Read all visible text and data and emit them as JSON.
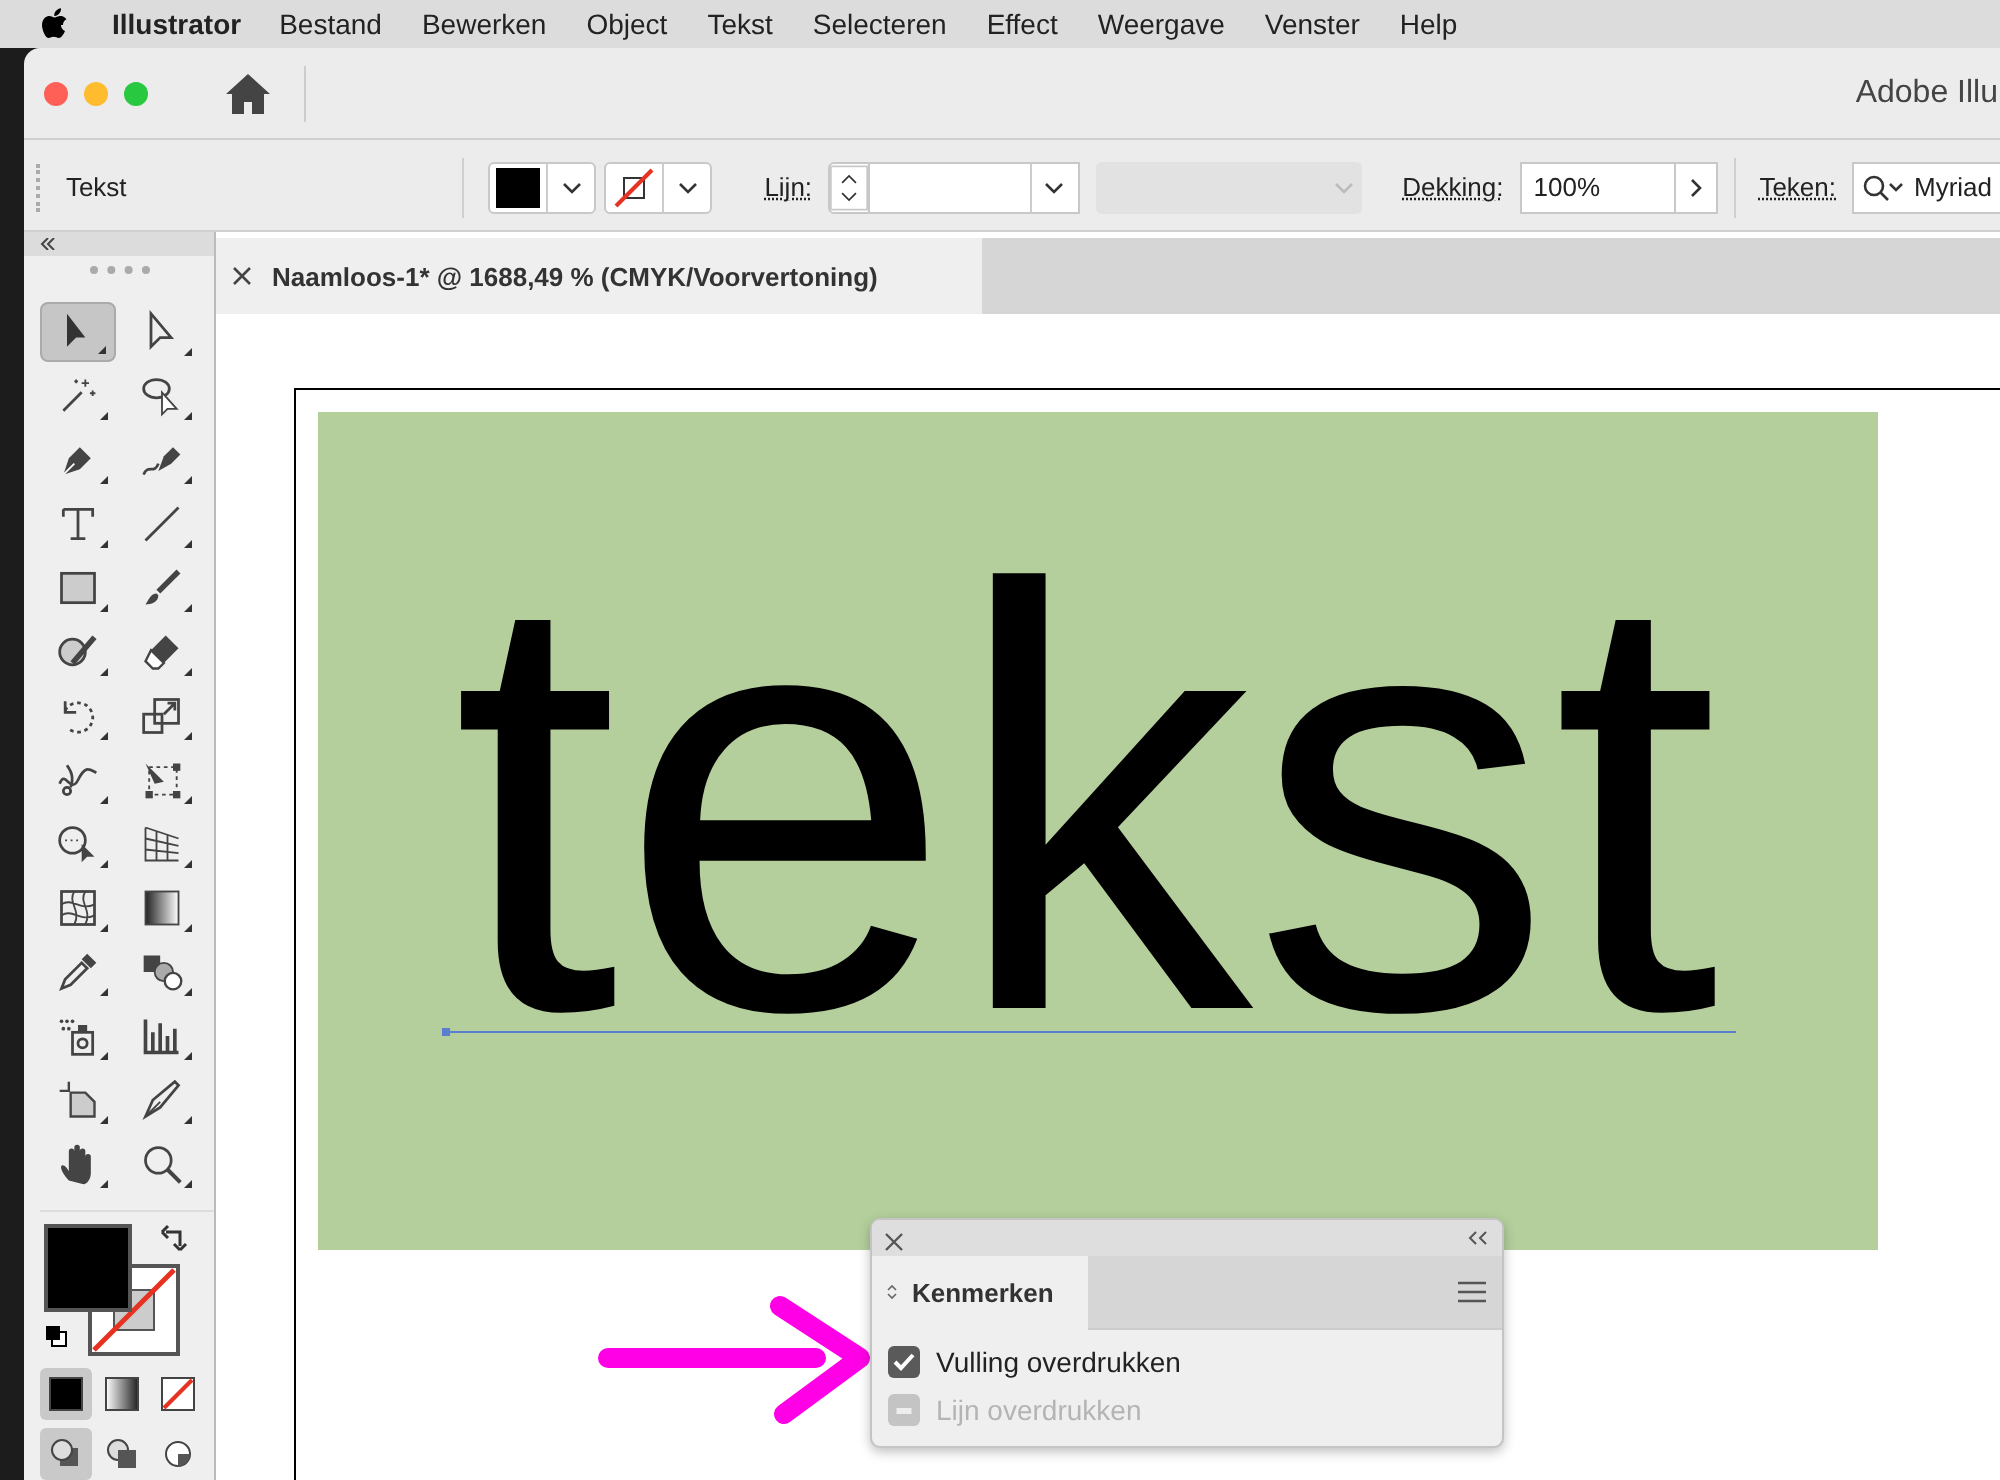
{
  "menu_bar": {
    "app_name": "Illustrator",
    "items": [
      "Bestand",
      "Bewerken",
      "Object",
      "Tekst",
      "Selecteren",
      "Effect",
      "Weergave",
      "Venster",
      "Help"
    ]
  },
  "window": {
    "title": "Adobe Illu"
  },
  "control_bar": {
    "selection_label": "Tekst",
    "stroke_label": "Lijn:",
    "opacity_label": "Dekking:",
    "opacity_value": "100%",
    "character_label": "Teken:",
    "font_value": "Myriad"
  },
  "document_tab": {
    "title": "Naamloos-1* @ 1688,49 % (CMYK/Voorvertoning)"
  },
  "toolbox": {
    "tools": [
      {
        "selected": true
      },
      {
        "selected": false
      },
      {
        "selected": false
      },
      {
        "selected": false
      },
      {
        "selected": false
      },
      {
        "selected": false
      },
      {
        "selected": false
      },
      {
        "selected": false
      },
      {
        "selected": false
      },
      {
        "selected": false
      },
      {
        "selected": false
      },
      {
        "selected": false
      },
      {
        "selected": false
      },
      {
        "selected": false
      },
      {
        "selected": false
      },
      {
        "selected": false
      },
      {
        "selected": false
      },
      {
        "selected": false
      },
      {
        "selected": false
      },
      {
        "selected": false
      },
      {
        "selected": false
      },
      {
        "selected": false
      },
      {
        "selected": false
      },
      {
        "selected": false
      },
      {
        "selected": false
      },
      {
        "selected": false
      },
      {
        "selected": false
      },
      {
        "selected": false
      }
    ],
    "color_modes": [
      {
        "selected": true
      },
      {
        "selected": false
      },
      {
        "selected": false
      }
    ],
    "draw_modes": [
      {
        "selected": true
      },
      {
        "selected": false
      },
      {
        "selected": false
      }
    ]
  },
  "artboard": {
    "text": "tekst"
  },
  "attributes_panel": {
    "tab": "Kenmerken",
    "options": [
      {
        "label": "Vulling overdrukken",
        "checked": true,
        "disabled": false
      },
      {
        "label": "Lijn overdrukken",
        "checked": false,
        "disabled": true
      }
    ]
  }
}
